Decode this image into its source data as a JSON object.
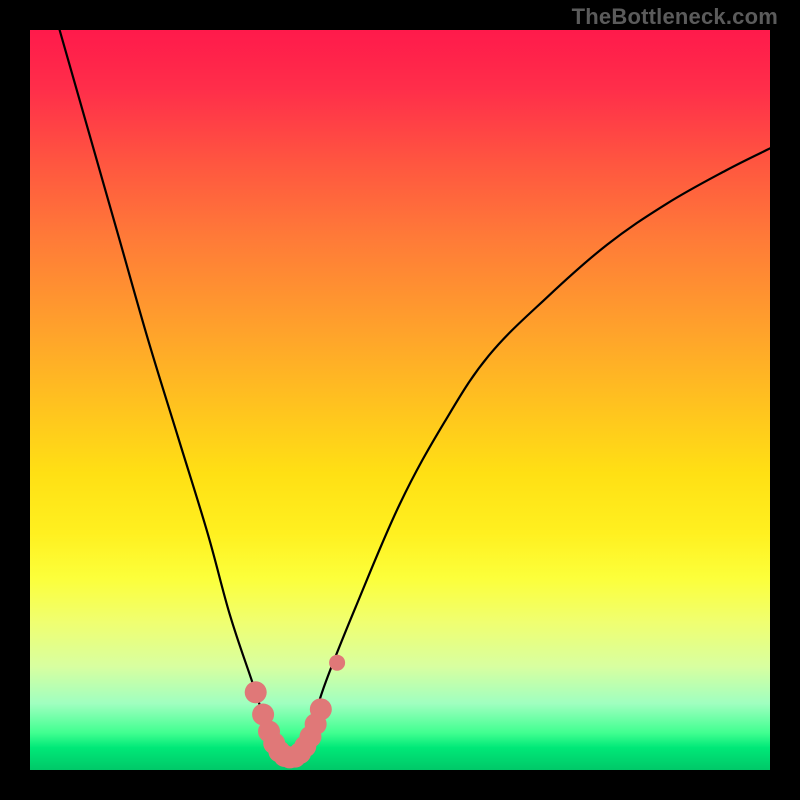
{
  "watermark": "TheBottleneck.com",
  "chart_data": {
    "type": "line",
    "title": "",
    "xlabel": "",
    "ylabel": "",
    "xlim": [
      0,
      100
    ],
    "ylim": [
      0,
      100
    ],
    "series": [
      {
        "name": "bottleneck-curve",
        "x": [
          4,
          8,
          12,
          16,
          20,
          24,
          27,
          30,
          32,
          33.5,
          35,
          36.5,
          38,
          40,
          44,
          50,
          56,
          62,
          70,
          78,
          86,
          94,
          100
        ],
        "y": [
          100,
          86,
          72,
          58,
          45,
          32,
          21,
          12,
          6,
          3,
          1.5,
          3,
          6,
          12,
          22,
          36,
          47,
          56,
          64,
          71,
          76.5,
          81,
          84
        ]
      }
    ],
    "markers": {
      "name": "highlight-dots",
      "color": "#e07878",
      "points": [
        {
          "x": 30.5,
          "y": 10.5
        },
        {
          "x": 31.5,
          "y": 7.5
        },
        {
          "x": 32.3,
          "y": 5.2
        },
        {
          "x": 33.0,
          "y": 3.6
        },
        {
          "x": 33.7,
          "y": 2.5
        },
        {
          "x": 34.4,
          "y": 1.9
        },
        {
          "x": 35.1,
          "y": 1.7
        },
        {
          "x": 35.8,
          "y": 1.8
        },
        {
          "x": 36.5,
          "y": 2.3
        },
        {
          "x": 37.2,
          "y": 3.2
        },
        {
          "x": 37.9,
          "y": 4.5
        },
        {
          "x": 38.6,
          "y": 6.2
        },
        {
          "x": 39.3,
          "y": 8.2
        },
        {
          "x": 41.5,
          "y": 14.5
        }
      ]
    },
    "background_gradient": {
      "type": "vertical",
      "stops": [
        {
          "pos": 0.0,
          "color": "#ff1a4b"
        },
        {
          "pos": 0.5,
          "color": "#ffc020"
        },
        {
          "pos": 0.74,
          "color": "#fcff3a"
        },
        {
          "pos": 1.0,
          "color": "#00c868"
        }
      ]
    }
  }
}
